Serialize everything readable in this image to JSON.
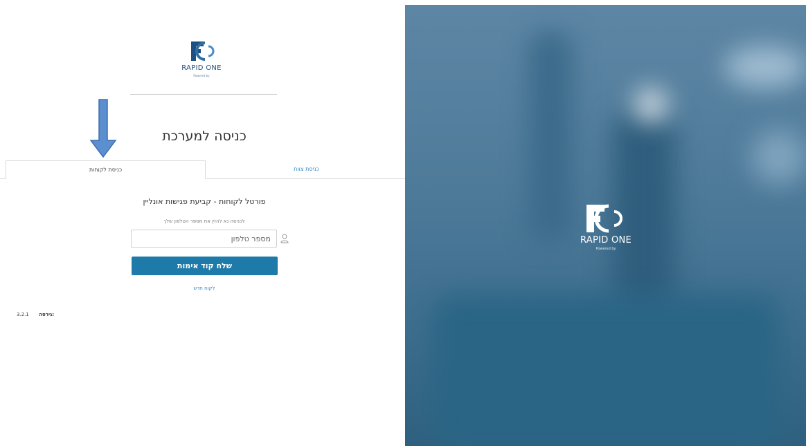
{
  "logo": {
    "brand": "RAPID ONE",
    "powered": "Powered by"
  },
  "page_title": "כניסה למערכת",
  "tabs": [
    {
      "label": "כניסת לקוחות",
      "active": true
    },
    {
      "label": "כניסת צוות",
      "active": false
    }
  ],
  "portal_heading": "פורטל לקוחות - קביעת פגישות אונליין",
  "instruction": "לכניסה נא להזין את מספר הטלפון שלך",
  "phone_field": {
    "placeholder": "מספר טלפון",
    "value": ""
  },
  "send_button_label": "שלח קוד אימות",
  "new_client_label": "לקוח חדש",
  "version": {
    "label": "גירסה:",
    "number": "3.2.1"
  },
  "colors": {
    "primary_button": "#1e7aa8",
    "link": "#3a8ac4",
    "arrow": "#5b8fd0"
  }
}
